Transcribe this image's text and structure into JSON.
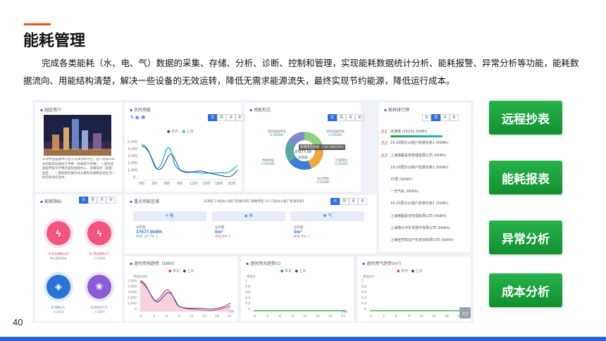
{
  "page": {
    "title": "能耗管理",
    "intro": "完成各类能耗（水、电、气）数据的采集、存储、分析、诊断、控制和管理，实现能耗数据统计分析、能耗报警、异常分析等功能，能耗数据流向、用能结构清楚，解决一些设备的无效运转，降低无需求能源流失，最终实现节约能源，降低运行成本。",
    "page_number": "40"
  },
  "features": [
    "远程抄表",
    "能耗报表",
    "异常分析",
    "成本分析"
  ],
  "dashboard": {
    "park_intro": {
      "title": "园区简介",
      "text": "天津中国金融中心位于天津市和平区，是一座高336米的超高层地标写字楼（高规格写字楼），一座包括超超甲级写字楼的国际金融中心、高端商务（配套）园区……一座配套的服务式公寓和高端精品商业为一体的商务综合体。"
    },
    "realtime": {
      "title": "实时用能",
      "tabs": [
        "日",
        "周",
        "月",
        "年"
      ],
      "legend": [
        "本日",
        "上日"
      ],
      "yticks": [
        "5,000",
        "4,000",
        "3,000",
        "2,000",
        "1,000",
        "0"
      ],
      "xticks": [
        "0时",
        "3时",
        "6时",
        "9时",
        "12时",
        "15时",
        "18时",
        "21时"
      ]
    },
    "energy_form": {
      "title": "用能形式",
      "tabs": [
        "日",
        "周",
        "月",
        "年"
      ],
      "tooltip": "照明用电用能: 0.00 kWh(0%)",
      "center_value": "37677.59",
      "center_label": "总用电",
      "labels": [
        {
          "name": "照明插座用电",
          "value": "0.00kWh"
        },
        {
          "name": "照明插座用电",
          "value": "0.00kWh"
        },
        {
          "name": "特殊用电",
          "value": "0.00kWh"
        },
        {
          "name": "空调用电",
          "value": "0.00kWh"
        },
        {
          "name": "动力用电",
          "value": "0.00kWh"
        }
      ]
    },
    "ranking": {
      "title": "能耗排行榜",
      "tabs": [
        "日",
        "周",
        "月",
        "年"
      ],
      "rows": [
        {
          "no": "01",
          "name": "天津塔",
          "value": "(25232.0kWh)"
        },
        {
          "no": "02",
          "name": "19-20层办公租户普通负荷1",
          "value": "(0kWh)"
        },
        {
          "no": "03",
          "name": "上海德赢投资管理有限公司",
          "value": "(0kWh)"
        },
        {
          "no": "",
          "name": "19-20层办公租户普通负荷2",
          "value": "(0kWh)"
        },
        {
          "no": "",
          "name": "37层",
          "value": "(0kWh)"
        },
        {
          "no": "",
          "name": "一代汽车",
          "value": "(0kWh)"
        },
        {
          "no": "",
          "name": "19-20层办公租户普通负荷2",
          "value": "(0kWh)"
        },
        {
          "no": "",
          "name": "上海德赢投资管理有限公司",
          "value": "(0kWh)"
        },
        {
          "no": "",
          "name": "上海德众汽车零部件有限公司",
          "value": "(0kWh)"
        },
        {
          "no": "",
          "name": "上海佳芳知识产权咨询有限公司",
          "value": "(0kWh)"
        }
      ]
    },
    "indicators": {
      "title": "能耗指标",
      "tabs": [
        "日",
        "周",
        "月",
        "年"
      ],
      "items": [
        {
          "value": "0.01kWh/㎡",
          "label": "单位面积用电"
        },
        {
          "value": "0.75kWh/人",
          "label": "人均用电"
        },
        {
          "value": "0.00t/人",
          "label": "人均用水"
        },
        {
          "value": "0.00m³/人",
          "label": "人均用气"
        }
      ]
    },
    "key_area": {
      "title": "重点用能区域",
      "filters": "天津塔  3-9层办公租户普通负荷1  南楼用电  10-17层办公租户普通负荷1",
      "tabs": [
        "日",
        "周",
        "月",
        "年"
      ],
      "cols": [
        {
          "icon": "电",
          "label": "总用量",
          "value": "37677.5kWh",
          "mom": "环比 -27.7% ↓"
        },
        {
          "icon": "水",
          "label": "总用量",
          "value": "0m³",
          "mom": "环比 0% ↑"
        },
        {
          "icon": "气",
          "label": "总用量",
          "value": "0m³",
          "mom": "环比 0% ↑"
        }
      ]
    },
    "elec_trend": {
      "title": "逐时用电趋势（kWh）",
      "unit": "单位/kWh",
      "legend": [
        "本日",
        "上日"
      ],
      "yticks": [
        "5,000",
        "4,000",
        "3,000",
        "2,000",
        "1,000",
        "0"
      ],
      "xticks": [
        "0",
        "3",
        "6",
        "9",
        "12",
        "15",
        "18",
        "21"
      ],
      "x_unit": "小时"
    },
    "water_trend": {
      "title": "逐时用水趋势(t)",
      "unit": "单位/t",
      "legend": [
        "本日",
        "上日"
      ],
      "yticks": [
        "1",
        "0.8",
        "0.6",
        "0.4",
        "0.2",
        "0"
      ],
      "xticks": [
        "0",
        "3",
        "6",
        "9",
        "12",
        "15",
        "18",
        "21"
      ],
      "x_unit": "小时"
    },
    "gas_trend": {
      "title": "逐时用气趋势(m³)",
      "unit": "单位/m³",
      "legend": [
        "本日",
        "上日"
      ],
      "yticks": [
        "1",
        "0.8",
        "0.6",
        "0.4",
        "0.2",
        "0"
      ],
      "xticks": [
        "0",
        "3",
        "6",
        "9",
        "12",
        "15",
        "18",
        "21"
      ]
    }
  },
  "colors": {
    "accent": "#e8541e",
    "blue": "#2463d6",
    "green": "#1aa43b",
    "today": "#1a3f9a",
    "yesterday": "#22b8d6"
  }
}
